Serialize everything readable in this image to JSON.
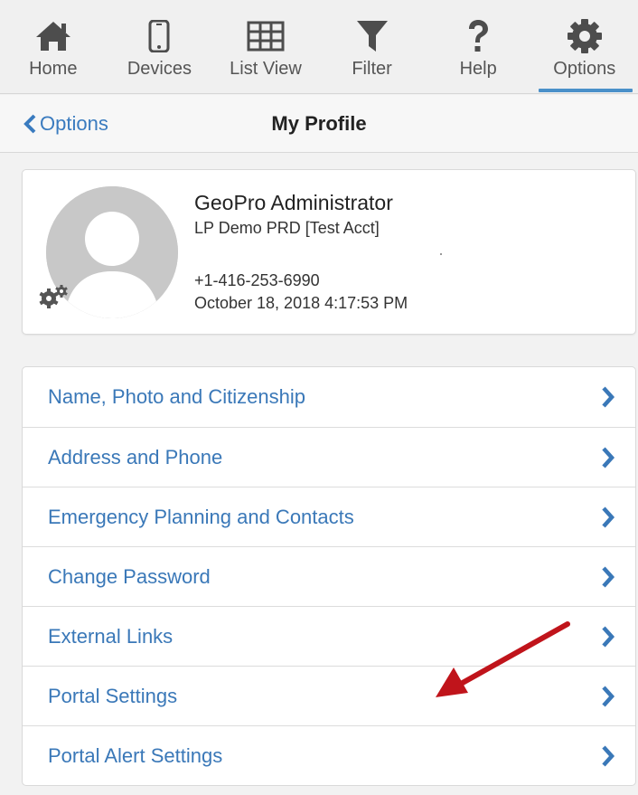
{
  "toolbar": {
    "items": [
      {
        "label": "Home",
        "icon": "home-icon"
      },
      {
        "label": "Devices",
        "icon": "mobile-device-icon"
      },
      {
        "label": "List View",
        "icon": "table-grid-icon"
      },
      {
        "label": "Filter",
        "icon": "filter-funnel-icon"
      },
      {
        "label": "Help",
        "icon": "question-mark-icon"
      },
      {
        "label": "Options",
        "icon": "gear-icon",
        "active": true
      }
    ]
  },
  "navbar": {
    "back_label": "Options",
    "title": "My Profile"
  },
  "profile": {
    "name": "GeoPro Administrator",
    "account": "LP Demo PRD [Test Acct]",
    "phone": "+1-416-253-6990",
    "timestamp": "October 18, 2018 4:17:53 PM"
  },
  "menu": {
    "items": [
      {
        "label": "Name, Photo and Citizenship"
      },
      {
        "label": "Address and Phone"
      },
      {
        "label": "Emergency Planning and Contacts"
      },
      {
        "label": "Change Password"
      },
      {
        "label": "External Links"
      },
      {
        "label": "Portal Settings"
      },
      {
        "label": "Portal Alert Settings"
      }
    ]
  },
  "colors": {
    "accent": "#3a78b8",
    "active_underline": "#4a90c9",
    "icon": "#4d4d4d",
    "annotation_arrow": "#c0141b"
  }
}
